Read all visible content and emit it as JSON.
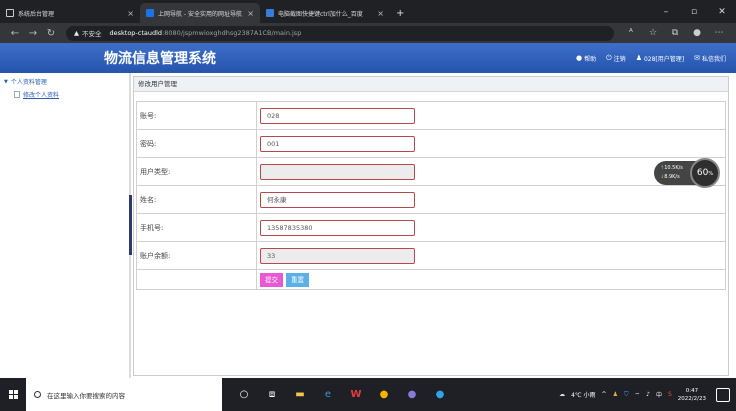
{
  "browser": {
    "tabs": [
      {
        "title": "系统后台管理"
      },
      {
        "title": "上网导航 - 安全实用的网址导航"
      },
      {
        "title": "电脑截图快捷键ctrl加什么_百度"
      }
    ],
    "new_tab": "+",
    "url_warning": "▲",
    "url_security": "不安全",
    "url_host": "desktop-ctaudld",
    "url_path": ":8080/jspmwioxghdhsg2387A1CB/main.jsp"
  },
  "app": {
    "title": "物流信息管理系统",
    "header_links": [
      {
        "icon": "help-icon",
        "label": "帮助"
      },
      {
        "icon": "power-icon",
        "label": "注销"
      },
      {
        "icon": "user-icon",
        "label": "028[用户管理]"
      },
      {
        "icon": "mail-icon",
        "label": "私信我们"
      }
    ]
  },
  "sidebar": {
    "group": "个人资料管理",
    "items": [
      {
        "label": "修改个人资料"
      }
    ]
  },
  "main": {
    "breadcrumb": "修改用户管理",
    "fields": [
      {
        "label": "账号:",
        "value": "028",
        "readonly": false
      },
      {
        "label": "密码:",
        "value": "001",
        "readonly": false
      },
      {
        "label": "用户类型:",
        "value": "",
        "readonly": true
      },
      {
        "label": "姓名:",
        "value": "何永康",
        "readonly": false
      },
      {
        "label": "手机号:",
        "value": "13587835380",
        "readonly": false
      },
      {
        "label": "账户余额:",
        "value": "33",
        "readonly": true
      }
    ],
    "submit_label": "提交",
    "reset_label": "重置"
  },
  "speed_widget": {
    "upload": "10.5",
    "upload_unit": "K/s",
    "download": "8.9",
    "download_unit": "K/s",
    "percent": "60",
    "percent_unit": "%"
  },
  "taskbar": {
    "search_placeholder": "在这里输入你要搜索的内容",
    "weather": "4℃ 小雨",
    "input_method": "中",
    "time": "0:47",
    "date": "2022/2/23"
  }
}
